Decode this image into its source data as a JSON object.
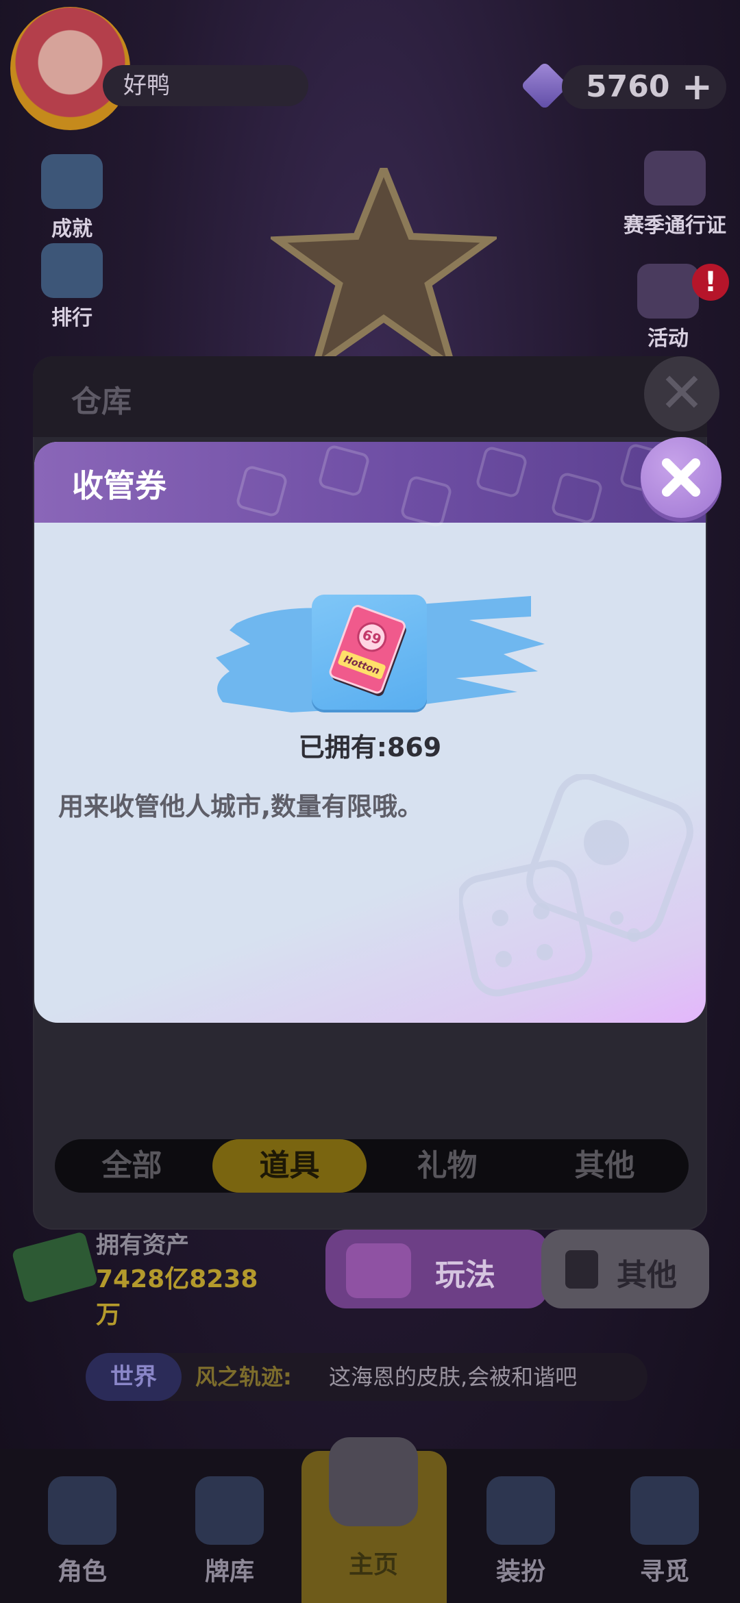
{
  "hud": {
    "player_name": "好鸭",
    "gems": "5760",
    "plus": "+"
  },
  "left_buttons": [
    {
      "label": "成就",
      "icon": "trophy-icon"
    },
    {
      "label": "排行",
      "icon": "ranking-icon"
    }
  ],
  "right_buttons": [
    {
      "label": "赛季通行证",
      "icon": "season-pass-icon"
    },
    {
      "label": "活动",
      "icon": "calendar-icon",
      "badge": "!"
    }
  ],
  "warehouse": {
    "title": "仓库",
    "close": "✕",
    "tabs": [
      {
        "label": "全部",
        "active": false
      },
      {
        "label": "道具",
        "active": true
      },
      {
        "label": "礼物",
        "active": false
      },
      {
        "label": "其他",
        "active": false
      }
    ]
  },
  "assets": {
    "label": "拥有资产",
    "value": "7428亿8238万"
  },
  "buttons": {
    "play": "玩法",
    "other": "其他"
  },
  "chat": {
    "channel": "世界",
    "user": "风之轨迹:",
    "message": "这海恩的皮肤,会被和谐吧"
  },
  "nav": [
    {
      "label": "角色",
      "icon": "character-icon",
      "active": false
    },
    {
      "label": "牌库",
      "icon": "cards-icon",
      "active": false
    },
    {
      "label": "主页",
      "icon": "home-mascot-icon",
      "active": true
    },
    {
      "label": "装扮",
      "icon": "backpack-icon",
      "active": false
    },
    {
      "label": "寻觅",
      "icon": "search-mascot-icon",
      "active": false
    }
  ],
  "modal": {
    "title": "收管券",
    "owned": "已拥有:869",
    "description": "用来收管他人城市,数量有限哦。",
    "card_text": "69",
    "card_subtext": "Hotton"
  },
  "colors": {
    "modal_header": "#6e4ea4",
    "modal_body": "#d7e1f0",
    "close_button": "#a077d3",
    "item_card": "#7fc6f7",
    "tab_active": "#7a6510"
  }
}
